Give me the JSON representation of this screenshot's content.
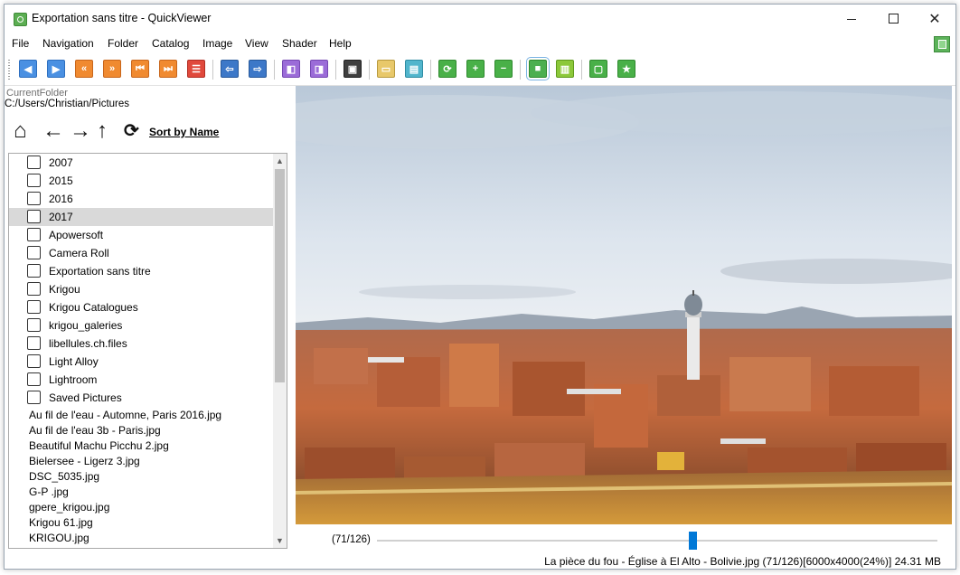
{
  "window": {
    "title": "Exportation sans titre - QuickViewer"
  },
  "menu": [
    "File",
    "Navigation",
    "Folder",
    "Catalog",
    "Image",
    "View",
    "Shader",
    "Help"
  ],
  "toolbar": {
    "buttons": [
      {
        "name": "previous-image-icon",
        "glyph": "◀"
      },
      {
        "name": "next-image-icon",
        "glyph": "▶"
      },
      {
        "name": "fast-backward-icon",
        "glyph": "«"
      },
      {
        "name": "fast-forward-icon",
        "glyph": "»"
      },
      {
        "name": "first-image-icon",
        "glyph": "⏮"
      },
      {
        "name": "last-image-icon",
        "glyph": "⏭"
      },
      {
        "name": "playlist-icon",
        "glyph": "☰"
      },
      {
        "name": "open-left-icon",
        "glyph": "⇦"
      },
      {
        "name": "open-right-icon",
        "glyph": "⇨"
      },
      {
        "name": "page-left-icon",
        "glyph": "◧"
      },
      {
        "name": "page-right-icon",
        "glyph": "◨"
      },
      {
        "name": "image-info-icon",
        "glyph": "▣"
      },
      {
        "name": "open-folder-icon",
        "glyph": "▭"
      },
      {
        "name": "catalog-icon",
        "glyph": "▤"
      },
      {
        "name": "rotate-icon",
        "glyph": "⟳"
      },
      {
        "name": "zoom-in-icon",
        "glyph": "+"
      },
      {
        "name": "zoom-out-icon",
        "glyph": "−"
      },
      {
        "name": "single-view-icon",
        "glyph": "■"
      },
      {
        "name": "double-view-icon",
        "glyph": "▥"
      },
      {
        "name": "fullscreen-icon",
        "glyph": "▢"
      },
      {
        "name": "pin-icon",
        "glyph": "★"
      }
    ]
  },
  "panel": {
    "current_folder_label": "CurrentFolder",
    "current_folder_path": "C:/Users/Christian/Pictures",
    "sort_label": "Sort by Name"
  },
  "folders": [
    {
      "label": "2007",
      "selected": false
    },
    {
      "label": "2015",
      "selected": false
    },
    {
      "label": "2016",
      "selected": false
    },
    {
      "label": "2017",
      "selected": true
    },
    {
      "label": "Apowersoft",
      "selected": false
    },
    {
      "label": "Camera Roll",
      "selected": false
    },
    {
      "label": "Exportation sans titre",
      "selected": false
    },
    {
      "label": "Krigou",
      "selected": false
    },
    {
      "label": "Krigou Catalogues",
      "selected": false
    },
    {
      "label": "krigou_galeries",
      "selected": false
    },
    {
      "label": "libellules.ch.files",
      "selected": false
    },
    {
      "label": "Light Alloy",
      "selected": false
    },
    {
      "label": "Lightroom",
      "selected": false
    },
    {
      "label": "Saved Pictures",
      "selected": false
    }
  ],
  "files": [
    "Au fil de l'eau - Automne, Paris 2016.jpg",
    "Au fil de l'eau 3b - Paris.jpg",
    "Beautiful Machu Picchu 2.jpg",
    "Bielersee - Ligerz 3.jpg",
    "DSC_5035.jpg",
    "G-P .jpg",
    "gpere_krigou.jpg",
    "Krigou 61.jpg",
    "KRIGOU.jpg"
  ],
  "viewer": {
    "page_indicator": "(71/126)",
    "page_position": 0.563,
    "status": "La pièce du fou - Église à El Alto - Bolivie.jpg (71/126)[6000x4000(24%)] 24.31 MB"
  }
}
